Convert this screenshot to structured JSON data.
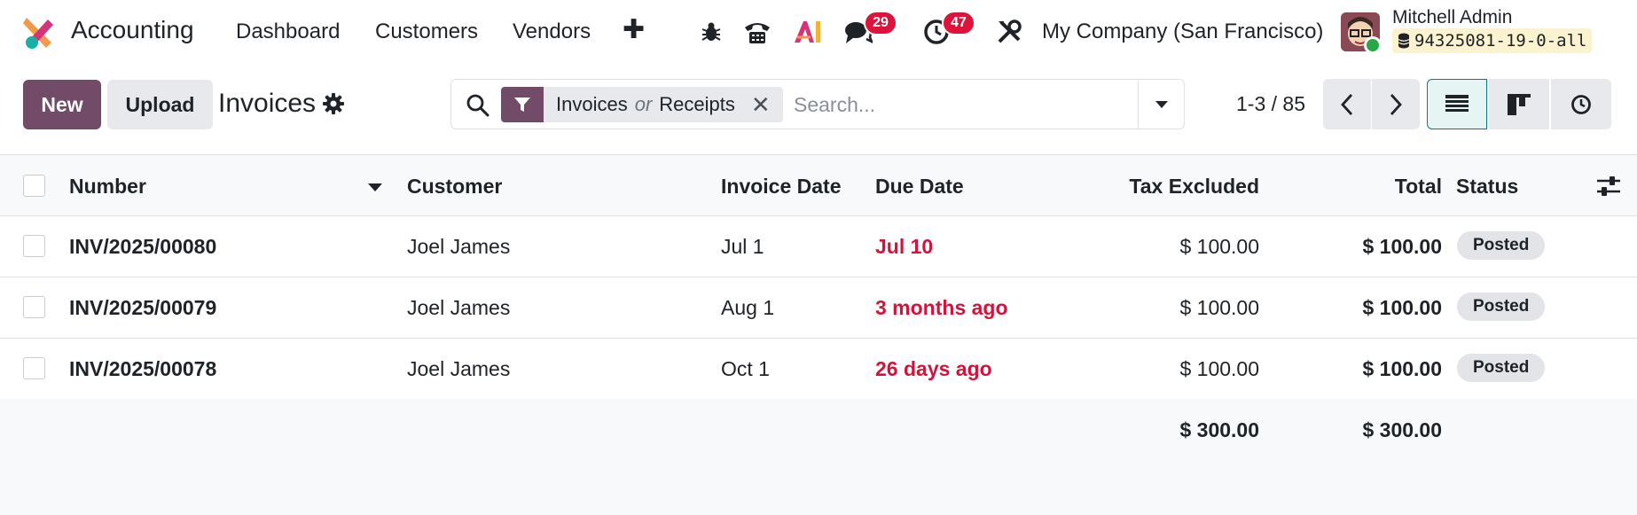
{
  "navbar": {
    "app_name": "Accounting",
    "menu": [
      "Dashboard",
      "Customers",
      "Vendors"
    ],
    "icons": [
      "bug-icon",
      "phone-icon",
      "ai-icon",
      "chat-icon",
      "clock-icon",
      "tools-icon"
    ],
    "messages_badge": "29",
    "activities_badge": "47",
    "company": "My Company (San Francisco)",
    "user_name": "Mitchell Admin",
    "database": "94325081-19-0-all"
  },
  "control": {
    "new_label": "New",
    "upload_label": "Upload",
    "title": "Invoices",
    "facet_first": "Invoices",
    "facet_or": "or",
    "facet_second": "Receipts",
    "search_placeholder": "Search...",
    "pager": "1-3 / 85"
  },
  "list": {
    "columns": {
      "number": "Number",
      "customer": "Customer",
      "invoice_date": "Invoice Date",
      "due_date": "Due Date",
      "tax_excluded": "Tax Excluded",
      "total": "Total",
      "status": "Status"
    },
    "rows": [
      {
        "number": "INV/2025/00080",
        "customer": "Joel James",
        "invoice_date": "Jul 1",
        "due_date": "Jul 10",
        "tax_excluded": "$ 100.00",
        "total": "$ 100.00",
        "status": "Posted"
      },
      {
        "number": "INV/2025/00079",
        "customer": "Joel James",
        "invoice_date": "Aug 1",
        "due_date": "3 months ago",
        "tax_excluded": "$ 100.00",
        "total": "$ 100.00",
        "status": "Posted"
      },
      {
        "number": "INV/2025/00078",
        "customer": "Joel James",
        "invoice_date": "Oct 1",
        "due_date": "26 days ago",
        "tax_excluded": "$ 100.00",
        "total": "$ 100.00",
        "status": "Posted"
      }
    ],
    "totals": {
      "tax_excluded": "$ 300.00",
      "total": "$ 300.00"
    }
  },
  "colors": {
    "brand": "#714b67",
    "overdue": "#d0143c",
    "badge": "#dc143c",
    "active_view": "#017e84"
  }
}
